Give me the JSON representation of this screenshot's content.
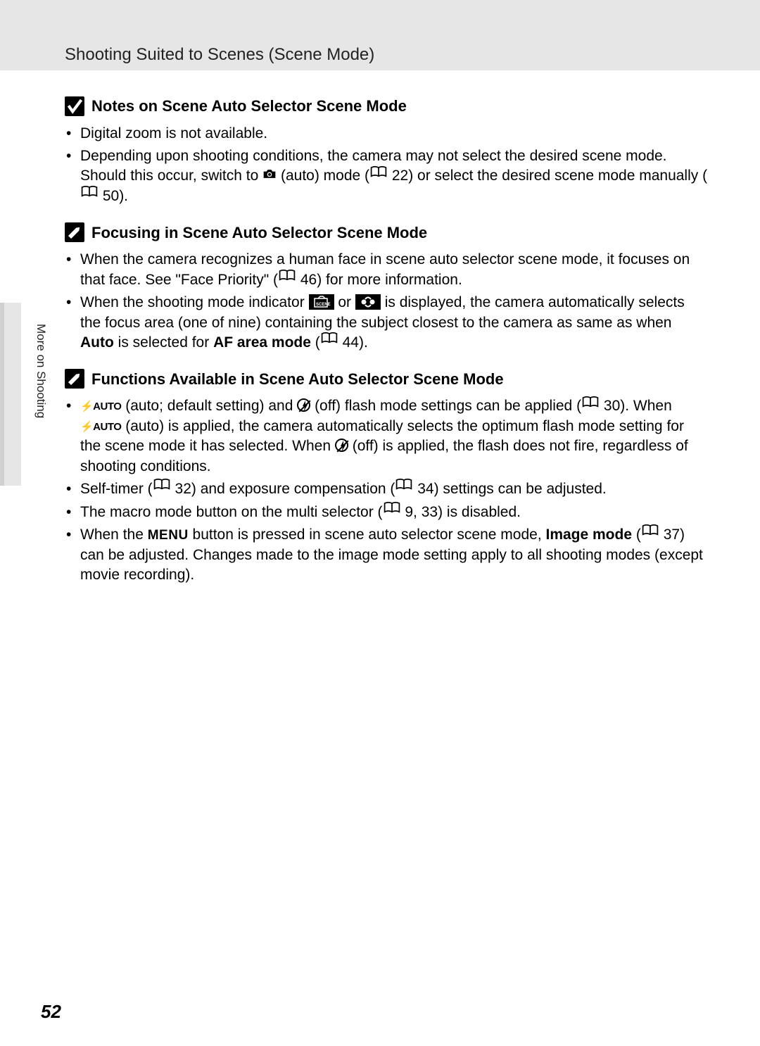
{
  "header": {
    "title": "Shooting Suited to Scenes (Scene Mode)"
  },
  "sections": {
    "notes": {
      "title": "Notes on Scene Auto Selector Scene Mode",
      "b1": "Digital zoom is not available.",
      "b2a": "Depending upon shooting conditions, the camera may not select the desired scene mode. Should this occur, switch to ",
      "b2b": " (auto) mode (",
      "b2c": " 22) or select the desired scene mode manually (",
      "b2d": " 50)."
    },
    "focus": {
      "title": "Focusing in Scene Auto Selector Scene Mode",
      "b1a": "When the camera recognizes a human face in scene auto selector scene mode, it focuses on that face. See \"Face Priority\" (",
      "b1b": " 46) for more information.",
      "b2a": "When the shooting mode indicator ",
      "b2b": " or ",
      "b2c": " is displayed, the camera automatically selects the focus area (one of nine) containing the subject closest to the camera as same as when ",
      "b2_auto": "Auto",
      "b2d": " is selected for ",
      "b2_af": "AF area mode",
      "b2e": " (",
      "b2f": " 44)."
    },
    "funcs": {
      "title": "Functions Available in Scene Auto Selector Scene Mode",
      "b1a": " (auto; default setting) and ",
      "b1b": " (off) flash mode settings can be applied (",
      "b1c": " 30). When ",
      "b1d": " (auto) is applied, the camera automatically selects the optimum flash mode setting for the scene mode it has selected. When ",
      "b1e": " (off) is applied, the flash does not fire, regardless of shooting conditions.",
      "b2a": "Self-timer (",
      "b2b": " 32) and exposure compensation (",
      "b2c": " 34) settings can be adjusted.",
      "b3a": "The macro mode button on the multi selector (",
      "b3b": " 9, 33) is disabled.",
      "b4a": "When the ",
      "b4_menu": "MENU",
      "b4b": " button is pressed in scene auto selector scene mode, ",
      "b4_img": "Image mode",
      "b4c": " (",
      "b4d": " 37) can be adjusted. Changes made to the image mode setting apply to all shooting modes (except movie recording)."
    }
  },
  "glyphs": {
    "flash_auto": "⚡AUTO"
  },
  "tab": {
    "label": "More on Shooting"
  },
  "page": {
    "number": "52"
  }
}
